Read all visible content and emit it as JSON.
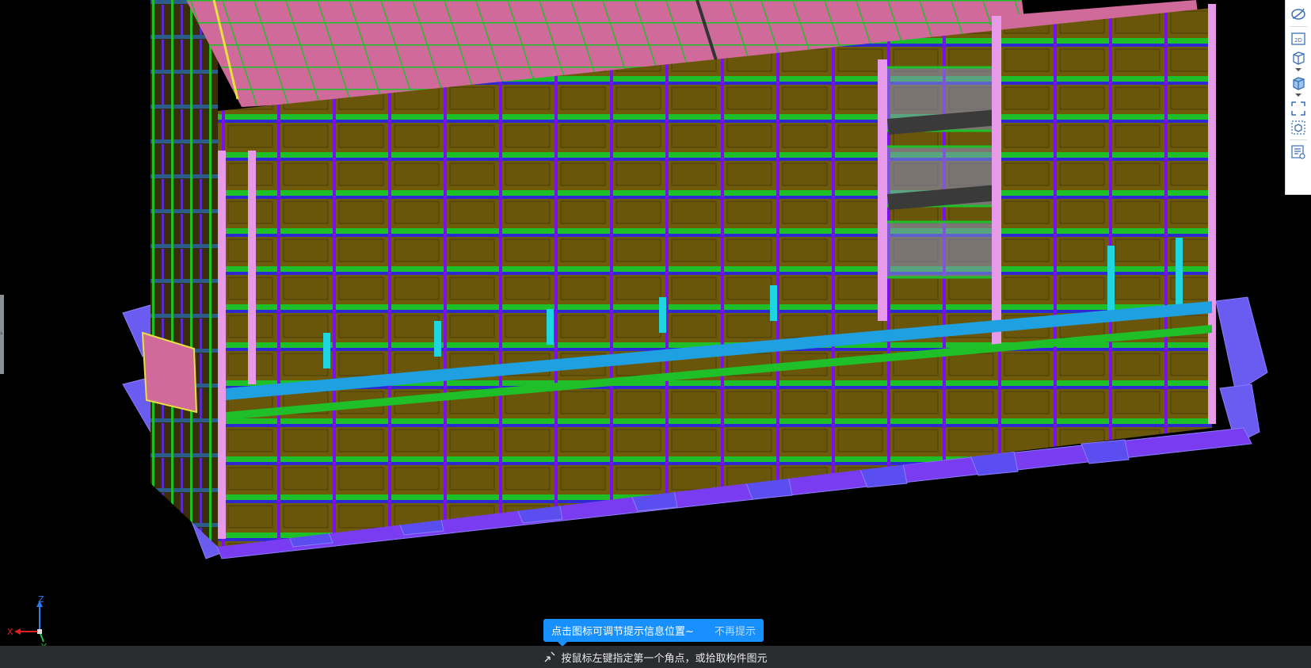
{
  "viewport": {
    "scene": "3D building model"
  },
  "toolbar": {
    "buttons": [
      {
        "name": "orbit-icon"
      },
      {
        "name": "2d-view-icon",
        "label": "2D"
      },
      {
        "name": "3d-box-icon"
      },
      {
        "name": "shaded-box-icon"
      },
      {
        "name": "fit-view-icon"
      },
      {
        "name": "component-view-icon"
      },
      {
        "name": "properties-list-icon"
      }
    ]
  },
  "axis": {
    "x": "X",
    "y": "Y",
    "z": "Z"
  },
  "tip": {
    "text": "点击图标可调节提示信息位置~",
    "dismiss": "不再提示"
  },
  "status": {
    "text": "按鼠标左键指定第一个角点，或拾取构件图元"
  },
  "colors": {
    "background": "#000000",
    "roof": "#d06a9a",
    "grid_green": "#1fbf2a",
    "wall_olive": "#6f5a0a",
    "column_purple": "#7a10f0",
    "glass_blue": "#2c2ad0",
    "cyan": "#1fd6e0",
    "foundation": "#6a5cf0",
    "tip_blue": "#1890ff",
    "status_bg": "#2a2c2f"
  }
}
